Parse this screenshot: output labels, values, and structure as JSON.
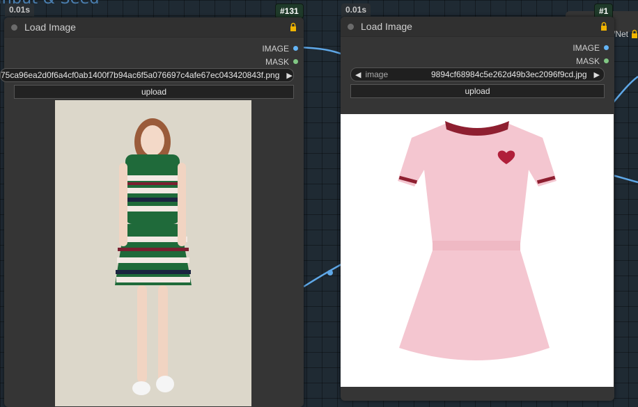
{
  "group": {
    "title": "Input & Seed"
  },
  "nodes": [
    {
      "id_badge": "#131",
      "timing": "0.01s",
      "title": "Load Image",
      "outputs": [
        {
          "label": "IMAGE",
          "color": "#64b5f6"
        },
        {
          "label": "MASK",
          "color": "#81c784"
        }
      ],
      "combo_value": "75ca96ea2d0f6a4cf0ab1400f7b94ac6f5a076697c4afe67ec043420843f.png",
      "upload_label": "upload"
    },
    {
      "id_badge": "#1",
      "timing": "0.01s",
      "title": "Load Image",
      "outputs": [
        {
          "label": "IMAGE",
          "color": "#64b5f6"
        },
        {
          "label": "MASK",
          "color": "#81c784"
        }
      ],
      "combo_label": "image",
      "combo_value": "9894cf68984c5e262d49b3ec2096f9cd.jpg",
      "upload_label": "upload"
    }
  ],
  "offscreen": {
    "partial_title": "/Net",
    "timing_partial": "0.01"
  },
  "colors": {
    "wire": "#5fa8e8",
    "canvas": "#1f2a33",
    "node": "#353535"
  }
}
